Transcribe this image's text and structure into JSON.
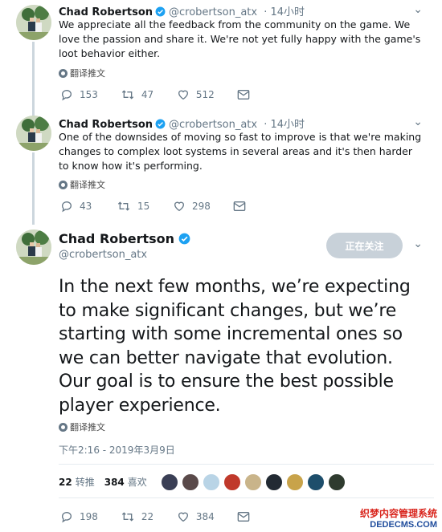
{
  "colors": {
    "verified": "#1da1f2",
    "muted": "#657786",
    "follow_bg": "#c8d1d9",
    "watermark_red": "#d9251d",
    "watermark_blue": "#1f4c9c"
  },
  "tweets": [
    {
      "name": "Chad Robertson",
      "handle": "@crobertson_atx",
      "time": "· 14小时",
      "text": "We appreciate all the feedback from the community on the game. We love the passion and share it. We're not yet fully happy with the game's loot behavior either.",
      "translate": "翻译推文",
      "replies": "153",
      "retweets": "47",
      "likes": "512"
    },
    {
      "name": "Chad Robertson",
      "handle": "@crobertson_atx",
      "time": "· 14小时",
      "text": "One of the downsides of moving so fast to improve is that we're making changes to complex loot systems in several areas and it's then harder to know how it's performing.",
      "translate": "翻译推文",
      "replies": "43",
      "retweets": "15",
      "likes": "298"
    }
  ],
  "main": {
    "name": "Chad Robertson",
    "handle": "@crobertson_atx",
    "follow_label": "正在关注",
    "text_lines": [
      "In the next few months, we’re expecting",
      "to make significant changes, but we’re",
      "starting with some incremental ones so",
      "we can better navigate that evolution.",
      "Our goal is to ensure the best possible",
      "player experience."
    ],
    "translate": "翻译推文",
    "timestamp": "下午2:16 - 2019年3月9日",
    "retweets_count": "22",
    "retweets_label": "转推",
    "likes_count": "384",
    "likes_label": "喜欢",
    "replies": "198",
    "retweets": "22",
    "likes": "384"
  },
  "icons": [
    "verified-icon",
    "reply-icon",
    "retweet-icon",
    "like-icon",
    "message-icon",
    "chevron-down-icon",
    "globe-icon"
  ],
  "watermark": {
    "line1": "织梦内容管理系统",
    "line2": "DEDECMS.COM"
  }
}
